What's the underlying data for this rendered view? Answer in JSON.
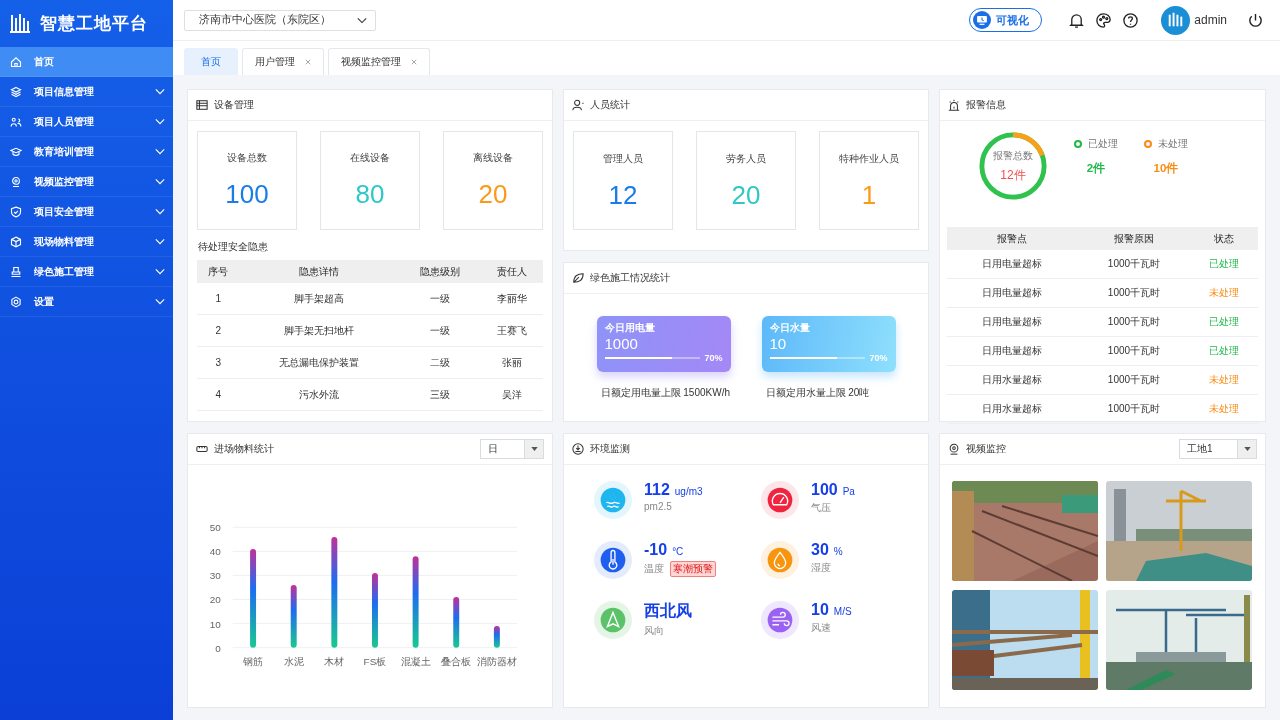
{
  "brand": {
    "title": "智慧工地平台"
  },
  "sidebar": {
    "items": [
      {
        "label": "首页",
        "kind": "home",
        "selected": true,
        "expandable": false
      },
      {
        "label": "项目信息管理",
        "kind": "layers",
        "selected": false,
        "expandable": true
      },
      {
        "label": "项目人员管理",
        "kind": "people",
        "selected": false,
        "expandable": true
      },
      {
        "label": "教育培训管理",
        "kind": "cap",
        "selected": false,
        "expandable": true
      },
      {
        "label": "视频监控管理",
        "kind": "camera",
        "selected": false,
        "expandable": true
      },
      {
        "label": "项目安全管理",
        "kind": "shield",
        "selected": false,
        "expandable": true
      },
      {
        "label": "现场物料管理",
        "kind": "cube",
        "selected": false,
        "expandable": true
      },
      {
        "label": "绿色施工管理",
        "kind": "stamp",
        "selected": false,
        "expandable": true
      },
      {
        "label": "设置",
        "kind": "gear",
        "selected": false,
        "expandable": true
      }
    ]
  },
  "header": {
    "project": "济南市中心医院（东院区）",
    "visual_button": "可视化",
    "user": "admin"
  },
  "tabs": [
    {
      "label": "首页",
      "selected": true,
      "closable": false
    },
    {
      "label": "用户管理",
      "selected": false,
      "closable": true
    },
    {
      "label": "视频监控管理",
      "selected": false,
      "closable": true
    }
  ],
  "devices": {
    "title": "设备管理",
    "stats": [
      {
        "label": "设备总数",
        "value": "100",
        "color": "#1a7ce6"
      },
      {
        "label": "在线设备",
        "value": "80",
        "color": "#2ec9c6"
      },
      {
        "label": "离线设备",
        "value": "20",
        "color": "#fa9a18"
      }
    ],
    "hazards_title": "待处理安全隐患",
    "columns": [
      "序号",
      "隐患详情",
      "隐患级别",
      "责任人"
    ],
    "rows": [
      [
        "1",
        "脚手架超高",
        "一级",
        "李丽华"
      ],
      [
        "2",
        "脚手架无扫地杆",
        "一级",
        "王赛飞"
      ],
      [
        "3",
        "无总漏电保护装置",
        "二级",
        "张丽"
      ],
      [
        "4",
        "污水外流",
        "三级",
        "吴洋"
      ]
    ]
  },
  "personnel": {
    "title": "人员统计",
    "stats": [
      {
        "label": "管理人员",
        "value": "12",
        "color": "#1a7ce6"
      },
      {
        "label": "劳务人员",
        "value": "20",
        "color": "#2ec9c6"
      },
      {
        "label": "特种作业人员",
        "value": "1",
        "color": "#fa9a18"
      }
    ]
  },
  "green": {
    "title": "绿色施工情况统计",
    "cards": [
      {
        "kind": "electricity",
        "label": "今日用电量",
        "value": "1000",
        "level": 0.7,
        "percent": "70%",
        "note": "日额定用电量上限  1500KW/h"
      },
      {
        "kind": "water",
        "label": "今日水量",
        "value": "10",
        "level": 0.7,
        "percent": "70%",
        "note": "日额定用水量上限  20吨"
      }
    ]
  },
  "alarms": {
    "title": "报警信息",
    "total_label": "报警总数",
    "total": "12件",
    "legend": [
      {
        "label": "已处理",
        "count": "2件",
        "color": "#22b84a"
      },
      {
        "label": "未处理",
        "count": "10件",
        "color": "#fa8c16"
      }
    ],
    "columns": [
      "报警点",
      "报警原因",
      "状态"
    ],
    "rows": [
      {
        "point": "日用电量超标",
        "reason": "1000千瓦时",
        "status": "已处理",
        "handled": true
      },
      {
        "point": "日用电量超标",
        "reason": "1000千瓦时",
        "status": "未处理",
        "handled": false
      },
      {
        "point": "日用电量超标",
        "reason": "1000千瓦时",
        "status": "已处理",
        "handled": true
      },
      {
        "point": "日用电量超标",
        "reason": "1000千瓦时",
        "status": "已处理",
        "handled": true
      },
      {
        "point": "日用水量超标",
        "reason": "1000千瓦时",
        "status": "未处理",
        "handled": false
      },
      {
        "point": "日用水量超标",
        "reason": "1000千瓦时",
        "status": "未处理",
        "handled": false
      }
    ]
  },
  "materials": {
    "title": "进场物料统计",
    "period": "日",
    "chart_data": {
      "type": "bar",
      "categories": [
        "钢筋",
        "水泥",
        "木材",
        "FS板",
        "混凝土",
        "叠合板",
        "消防器材"
      ],
      "series": [
        {
          "color": "#1f6cf0",
          "values": [
            41,
            26,
            46,
            31,
            38,
            21,
            9
          ]
        }
      ],
      "grid": true,
      "ylim": [
        0,
        50
      ],
      "yticks": [
        0,
        10,
        20,
        30,
        40,
        50
      ]
    }
  },
  "environment": {
    "title": "环境监测",
    "items": [
      {
        "kind": "pm25",
        "value": "112",
        "unit": "ug/m3",
        "label": "pm2.5"
      },
      {
        "kind": "pressure",
        "value": "100",
        "unit": "Pa",
        "label": "气压"
      },
      {
        "kind": "temperature",
        "value": "-10",
        "unit": "°C",
        "label": "温度",
        "warning": "寒潮预警"
      },
      {
        "kind": "humidity",
        "value": "30",
        "unit": "%",
        "label": "湿度"
      },
      {
        "kind": "wind-direction",
        "value": "西北风",
        "label": "风向"
      },
      {
        "kind": "wind-speed",
        "value": "10",
        "unit": "M/S",
        "label": "风速"
      }
    ]
  },
  "video": {
    "title": "视频监控",
    "site": "工地1"
  }
}
